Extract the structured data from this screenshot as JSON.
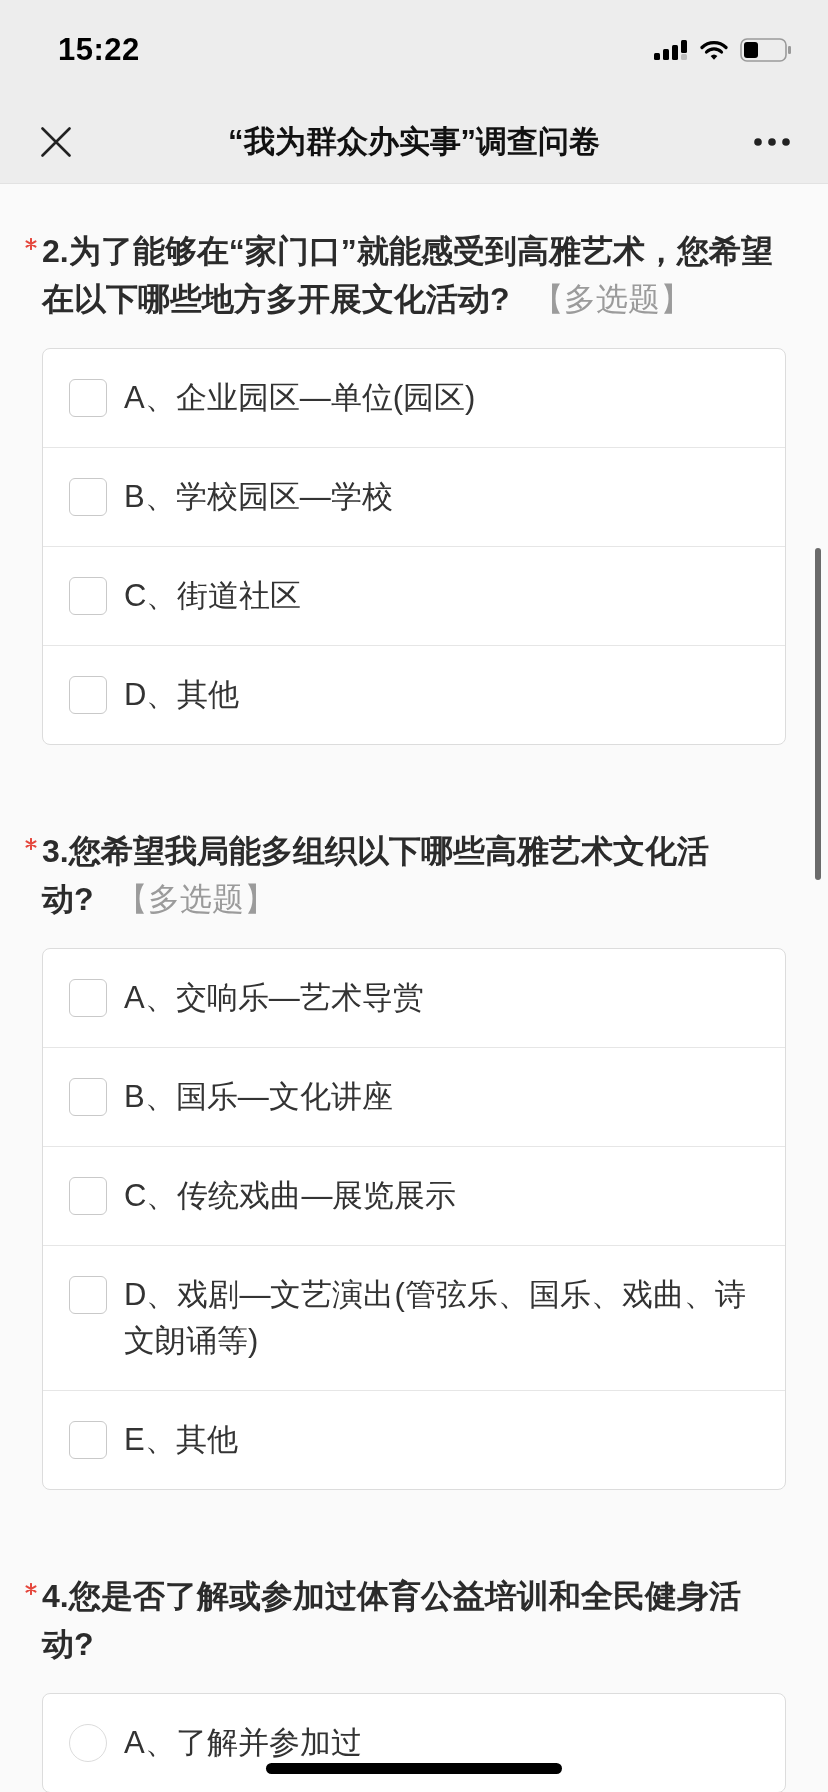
{
  "status_bar": {
    "time": "15:22"
  },
  "nav_bar": {
    "title": "“我为群众办实事”调查问卷"
  },
  "questions": [
    {
      "kind": "checkbox",
      "required": true,
      "text": "2.为了能够在“家门口”就能感受到高雅艺术，您希望在以下哪些地方多开展文化活动?",
      "tag": "【多选题】",
      "options": [
        {
          "label": "A、企业园区—单位(园区)",
          "checked": false
        },
        {
          "label": "B、学校园区—学校",
          "checked": false
        },
        {
          "label": "C、街道社区",
          "checked": false
        },
        {
          "label": "D、其他",
          "checked": false
        }
      ]
    },
    {
      "kind": "checkbox",
      "required": true,
      "text": "3.您希望我局能多组织以下哪些高雅艺术文化活动?",
      "tag": "【多选题】",
      "options": [
        {
          "label": "A、交响乐—艺术导赏",
          "checked": false
        },
        {
          "label": "B、国乐—文化讲座",
          "checked": false
        },
        {
          "label": "C、传统戏曲—展览展示",
          "checked": false
        },
        {
          "label": "D、戏剧—文艺演出(管弦乐、国乐、戏曲、诗文朗诵等)",
          "checked": false
        },
        {
          "label": "E、其他",
          "checked": false
        }
      ]
    },
    {
      "kind": "radio",
      "required": true,
      "text": "4.您是否了解或参加过体育公益培训和全民健身活动?",
      "options": [
        {
          "label": "A、了解并参加过",
          "selected": false
        }
      ]
    }
  ]
}
